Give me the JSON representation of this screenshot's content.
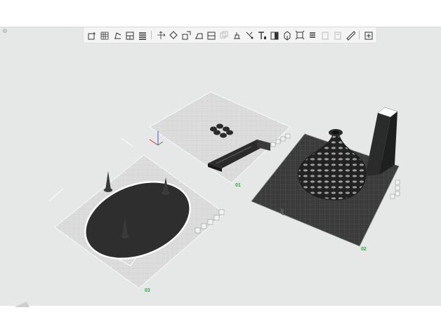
{
  "toolbar": {
    "buttons": [
      {
        "icon": "add-object-icon"
      },
      {
        "icon": "add-plate-icon"
      },
      {
        "icon": "orient-icon"
      },
      {
        "icon": "arrange-icon"
      },
      {
        "icon": "list-icon"
      },
      {
        "separator": true
      },
      {
        "icon": "move-icon"
      },
      {
        "icon": "rotate-icon"
      },
      {
        "icon": "scale-icon"
      },
      {
        "icon": "lay-on-face-icon"
      },
      {
        "icon": "cut-icon"
      },
      {
        "icon": "mesh-boolean-icon",
        "disabled": true
      },
      {
        "icon": "support-paint-icon"
      },
      {
        "icon": "seam-paint-icon"
      },
      {
        "icon": "text-icon"
      },
      {
        "icon": "color-paint-icon"
      },
      {
        "icon": "assembly-icon"
      },
      {
        "icon": "measure-icon"
      },
      {
        "icon": "variable-layer-icon"
      },
      {
        "icon": "split-objects-icon",
        "disabled": true
      },
      {
        "icon": "split-parts-icon",
        "disabled": true
      },
      {
        "icon": "ruler-icon"
      },
      {
        "separator": true
      },
      {
        "icon": "view-settings-icon"
      }
    ]
  },
  "plates": [
    {
      "label": "01"
    },
    {
      "label": "02"
    },
    {
      "label": "03"
    }
  ],
  "colors": {
    "viewport_bg": "#e6e7e7",
    "plate_light": "#d9d9d9",
    "plate_dark": "#3b3b3b",
    "plate_label": "#1fae3a",
    "model": "#2b2b2b"
  }
}
